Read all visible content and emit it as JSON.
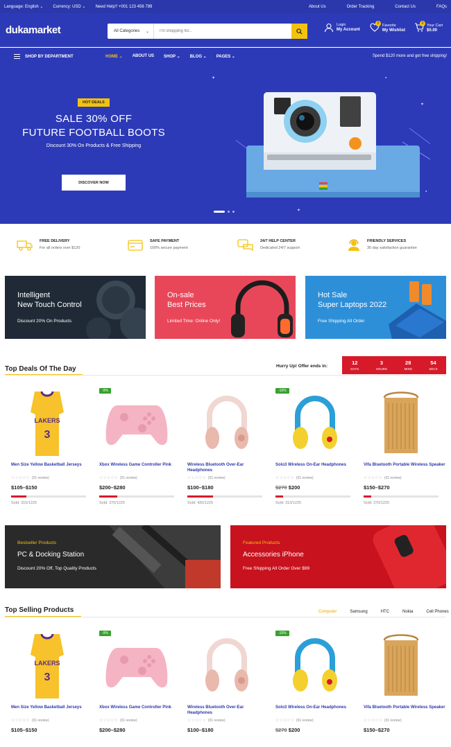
{
  "topbar": {
    "language": "Language: English",
    "currency": "Currency: USD",
    "help": "Need Help? +001 123 456 789",
    "links": [
      "About Us",
      "Order Tracking",
      "Contact Us",
      "FAQs"
    ]
  },
  "header": {
    "logo": "dukamarket",
    "category": "All Categories",
    "search_placeholder": "I'm shopping for...",
    "login_small": "Login",
    "login_big": "My Account",
    "fav_small": "Favorite",
    "fav_big": "My Wishlist",
    "fav_count": "0",
    "cart_small": "Your Cart",
    "cart_big": "$0.00",
    "cart_count": "0"
  },
  "nav": {
    "department": "SHOP BY DEPARTMENT",
    "items": [
      "HOME",
      "ABOUT US",
      "SHOP",
      "BLOG",
      "PAGES"
    ],
    "promo": "Spend $120 more and get free shipping!"
  },
  "hero": {
    "badge": "HOT DEALS",
    "line1": "SALE 30% OFF",
    "line2": "FUTURE FOOTBALL BOOTS",
    "sub": "Discount 30% On Products & Free Shipping",
    "button": "DISCOVER NOW",
    "slide_count": 3,
    "active_slide": 1
  },
  "features": [
    {
      "title": "FREE DELIVERY",
      "desc": "For all orders over $120",
      "icon": "truck-icon"
    },
    {
      "title": "SAFE PAYMENT",
      "desc": "100% secure payment",
      "icon": "credit-card-icon"
    },
    {
      "title": "24/7 HELP CENTER",
      "desc": "Dedicated 24/7 support",
      "icon": "chat-icon"
    },
    {
      "title": "FRIENDLY SERVICES",
      "desc": "30 day satisfaction guarantee",
      "icon": "support-agent-icon"
    }
  ],
  "banners": [
    {
      "line1": "Intelligent",
      "line2": "New Touch Control",
      "sub": "Discount 20% On Products",
      "color": "#1f2a36"
    },
    {
      "line1": "On-sale",
      "line2": "Best Prices",
      "sub": "Limited Time: Online Only!",
      "color": "#e8475a"
    },
    {
      "line1": "Hot Sale",
      "line2": "Super Laptops 2022",
      "sub": "Free Shipping All Order",
      "color": "#2e8fd9"
    }
  ],
  "deals": {
    "title": "Top Deals Of The Day",
    "hurry": "Hurry Up! Offer ends in:",
    "timer": [
      {
        "value": "12",
        "unit": "DAYS"
      },
      {
        "value": "3",
        "unit": "HOURS"
      },
      {
        "value": "28",
        "unit": "MINS"
      },
      {
        "value": "54",
        "unit": "SECS"
      }
    ],
    "products": [
      {
        "name": "Men Size Yellow Basketball Jerseys",
        "reviews": "(01 review)",
        "old": "",
        "price": "$105–$150",
        "sold": "Sold: 315/1225",
        "progress": 0.2,
        "discount": ""
      },
      {
        "name": "Xbox Wireless Game Controller Pink",
        "reviews": "(01 review)",
        "old": "",
        "price": "$200–$280",
        "sold": "Sold: 370/1225",
        "progress": 0.24,
        "discount": "-9%"
      },
      {
        "name": "Wireless Bluetooth Over-Ear Headphones",
        "reviews": "(01 review)",
        "old": "",
        "price": "$100–$180",
        "sold": "Sold: 420/1225",
        "progress": 0.34,
        "discount": ""
      },
      {
        "name": "Solo3 Wireless On-Ear Headphones",
        "reviews": "(01 review)",
        "old": "$270",
        "price": "$200",
        "sold": "Sold: 313/1225",
        "progress": 0.1,
        "discount": "-10%"
      },
      {
        "name": "Vifa Bluetooth Portable Wireless Speaker",
        "reviews": "(01 review)",
        "old": "",
        "price": "$150–$270",
        "sold": "Sold: 370/1225",
        "progress": 0.1,
        "discount": ""
      }
    ]
  },
  "promo_banners": [
    {
      "tag": "Bestseller Products",
      "title": "PC & Docking Station",
      "sub": "Discount 20% Off, Top Quality Products"
    },
    {
      "tag": "Featured Products",
      "title": "Accessories iPhone",
      "sub": "Free Shipping All Order Over $99"
    }
  ],
  "top_selling": {
    "title": "Top Selling Products",
    "tabs": [
      "Computer",
      "Samsung",
      "HTC",
      "Nokia",
      "Cell Phones"
    ],
    "products": [
      {
        "name": "Men Size Yellow Basketball Jerseys",
        "reviews": "(01 review)",
        "old": "",
        "price": "$105–$150",
        "discount": ""
      },
      {
        "name": "Xbox Wireless Game Controller Pink",
        "reviews": "(01 review)",
        "old": "",
        "price": "$200–$280",
        "discount": "-9%"
      },
      {
        "name": "Wireless Bluetooth Over-Ear Headphones",
        "reviews": "(01 review)",
        "old": "",
        "price": "$100–$180",
        "discount": ""
      },
      {
        "name": "Solo3 Wireless On-Ear Headphones",
        "reviews": "(01 review)",
        "old": "$270",
        "price": "$200",
        "discount": "-10%"
      },
      {
        "name": "Vifa Bluetooth Portable Wireless Speaker",
        "reviews": "(01 review)",
        "old": "",
        "price": "$150–$270",
        "discount": ""
      }
    ]
  },
  "colors": {
    "brand": "#2c3ab8",
    "accent": "#f4c20d",
    "sale": "#d61a2a",
    "badge_green": "#37a12e"
  }
}
